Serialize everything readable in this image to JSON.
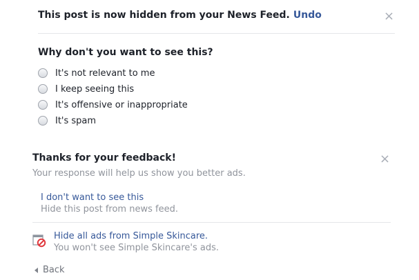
{
  "hidden_notice": {
    "message": "This post is now hidden from your News Feed.",
    "undo_label": "Undo",
    "close_glyph": "×"
  },
  "survey": {
    "question": "Why don't you want to see this?",
    "options": [
      "It's not relevant to me",
      "I keep seeing this",
      "It's offensive or inappropriate",
      "It's spam"
    ]
  },
  "feedback": {
    "title": "Thanks for your feedback!",
    "subtitle": "Your response will help us show you better ads.",
    "close_glyph": "×",
    "hide_post": {
      "link": "I don't want to see this",
      "description": "Hide this post from news feed."
    },
    "hide_ads": {
      "icon": "ad-block-icon",
      "link": "Hide all ads from Simple Skincare.",
      "description": "You won't see Simple Skincare's ads."
    },
    "back_label": "Back"
  },
  "colors": {
    "link": "#365899",
    "text": "#1d2129",
    "muted": "#90949c",
    "divider": "#e5e6e9",
    "block_red": "#e0393e"
  }
}
